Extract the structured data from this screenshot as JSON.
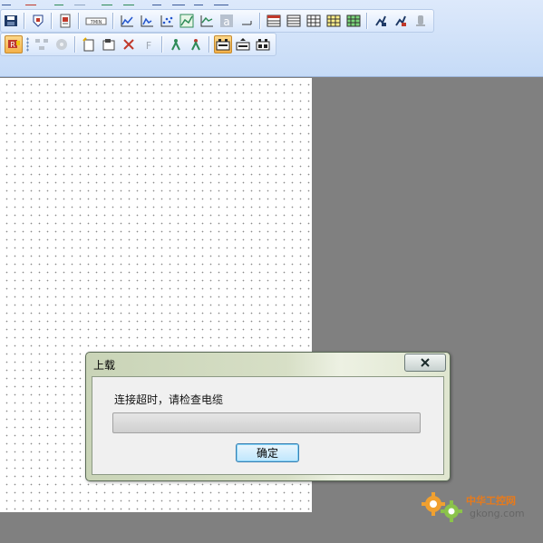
{
  "dialog": {
    "title": "上载",
    "message": "连接超时，请检查电缆",
    "progress_fraction": 0.0,
    "ok_label": "确定",
    "close_symbol": "✕"
  },
  "toolbar": {
    "row1": [
      "save-icon",
      "shield-icon",
      "document-icon",
      "module-label-icon",
      "line-chart-icon",
      "bar-axis-icon",
      "scatter-icon",
      "area-chart-icon",
      "trend-icon",
      "font-icon",
      "text-field-icon",
      "table-color-icon",
      "table-icon",
      "grid-icon",
      "grid-color-icon",
      "flash-icon",
      "flash-icon-2",
      "disabled-icon"
    ],
    "row2": [
      "flag-icon",
      "network-icon",
      "cd-icon",
      "new-file-icon",
      "folder-icon",
      "delete-icon",
      "f-icon",
      "green-figure-icon",
      "red-figure-icon",
      "plc-icon",
      "plc-upload-icon",
      "plc-download-icon"
    ],
    "f_label": "F",
    "font_label": "a"
  },
  "watermark": {
    "brand": "中华工控网",
    "domain": "gkong.com"
  },
  "colors": {
    "toolbar_bg": "#c6dbf7",
    "workspace_bg": "#808080",
    "canvas_bg": "#ffffff",
    "button_accent": "#3c7fb1",
    "watermark_orange": "#e87a1a"
  }
}
